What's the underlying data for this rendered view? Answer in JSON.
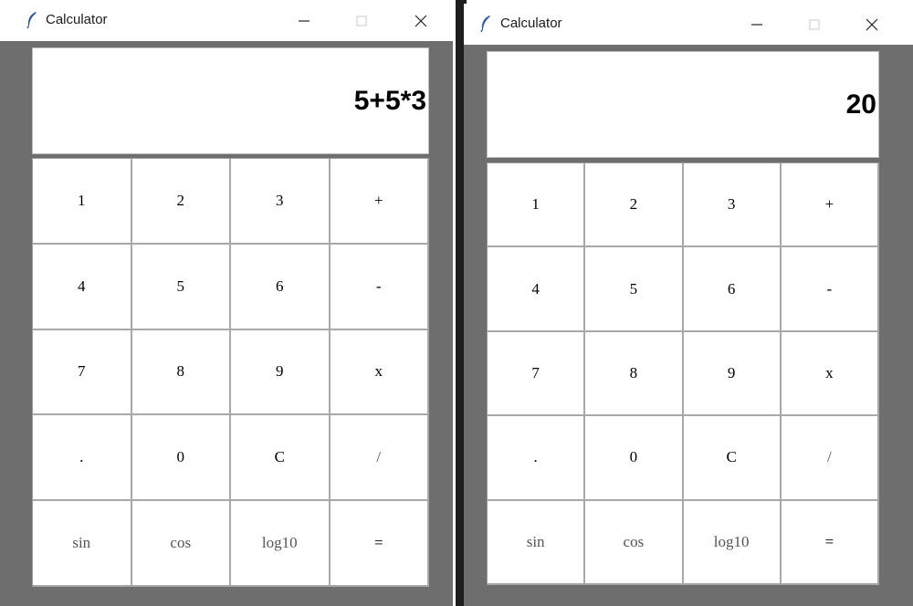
{
  "windows": [
    {
      "title": "Calculator",
      "display": "5+5*3",
      "controls": {
        "minimize_icon": "minimize-icon",
        "maximize_icon": "maximize-icon",
        "close_icon": "close-icon"
      }
    },
    {
      "title": "Calculator",
      "display": "20",
      "controls": {
        "minimize_icon": "minimize-icon",
        "maximize_icon": "maximize-icon",
        "close_icon": "close-icon"
      }
    }
  ],
  "keypad": [
    {
      "label": "1",
      "style": "normal"
    },
    {
      "label": "2",
      "style": "normal"
    },
    {
      "label": "3",
      "style": "normal"
    },
    {
      "label": "+",
      "style": "normal"
    },
    {
      "label": "4",
      "style": "normal"
    },
    {
      "label": "5",
      "style": "normal"
    },
    {
      "label": "6",
      "style": "normal"
    },
    {
      "label": "-",
      "style": "normal"
    },
    {
      "label": "7",
      "style": "normal"
    },
    {
      "label": "8",
      "style": "normal"
    },
    {
      "label": "9",
      "style": "normal"
    },
    {
      "label": "x",
      "style": "normal"
    },
    {
      "label": ".",
      "style": "normal"
    },
    {
      "label": "0",
      "style": "normal"
    },
    {
      "label": "C",
      "style": "normal"
    },
    {
      "label": "/",
      "style": "muted"
    },
    {
      "label": "sin",
      "style": "muted"
    },
    {
      "label": "cos",
      "style": "muted"
    },
    {
      "label": "log10",
      "style": "muted"
    },
    {
      "label": "=",
      "style": "normal"
    }
  ],
  "colors": {
    "window_frame": "#6e6e6e",
    "titlebar": "#ffffff",
    "key_border": "#a8a8a8",
    "muted_text": "#555555",
    "icon_feather": "#2f5aa8"
  }
}
